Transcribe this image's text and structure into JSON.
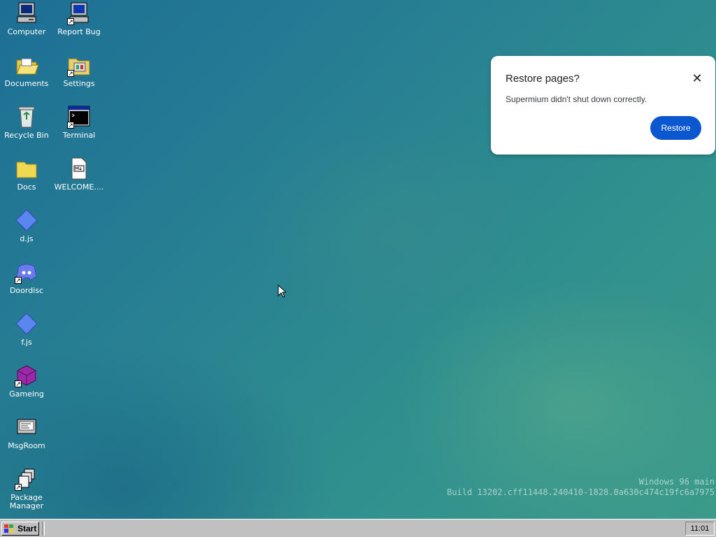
{
  "desktop_icons": [
    {
      "label": "Computer"
    },
    {
      "label": "Report Bug"
    },
    {
      "label": "Documents"
    },
    {
      "label": "Settings"
    },
    {
      "label": "Recycle Bin"
    },
    {
      "label": "Terminal"
    },
    {
      "label": "Docs"
    },
    {
      "label": "WELCOME...."
    },
    {
      "label": "d.js"
    },
    {
      "label": "Doordisc"
    },
    {
      "label": "f.js"
    },
    {
      "label": "Gameing"
    },
    {
      "label": "MsgRoom"
    },
    {
      "label": "Package Manager"
    }
  ],
  "watermark": {
    "line1": "Windows 96 main",
    "line2": "Build 13202.cff11448.240410-1828.0a630c474c19fc6a7975"
  },
  "popup": {
    "title": "Restore pages?",
    "message": "Supermium didn't shut down correctly.",
    "restore_label": "Restore",
    "close_icon": "close-icon"
  },
  "taskbar": {
    "start_label": "Start",
    "clock": "11:01"
  },
  "colors": {
    "accent": "#0b57d0",
    "taskbar": "#c0c0c0"
  }
}
